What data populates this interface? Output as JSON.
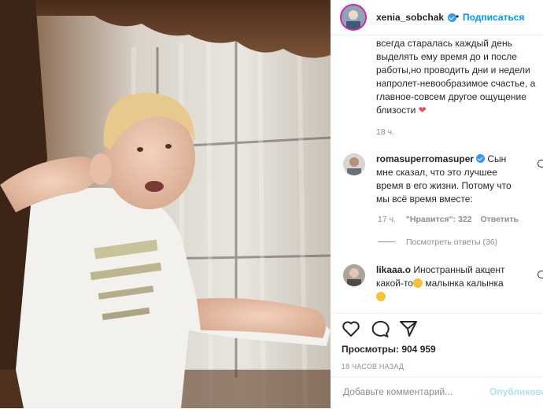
{
  "post": {
    "username": "xenia_sobchak",
    "follow_label": "Подписаться",
    "dot": "•",
    "caption_lines": [
      "всегда старалась каждый день",
      "выделять ему время до и после",
      "работы,но проводить дни и недели",
      "напролет-невообразимое счастье, а",
      "главное-совсем другое ощущение",
      "близости"
    ],
    "caption_time": "18 ч."
  },
  "comments": [
    {
      "username": "romasuperromasuper",
      "text_lines": [
        "Сын",
        "мне сказал, что это лучшее",
        "время в его жизни. Потому что",
        "мы всё время вместе:"
      ],
      "time": "17 ч.",
      "likes": "\"Нравится\": 322",
      "reply_label": "Ответить",
      "view_replies": "Посмотреть ответы (36)"
    },
    {
      "username": "likaaa.o",
      "text_lines": [
        "Иностранный акцент",
        "какой-то",
        "малынка калынка"
      ]
    }
  ],
  "actions": {
    "views_label": "Просмотры: 904 959",
    "time_ago": "18 ЧАСОВ НАЗАД",
    "comment_placeholder": "Добавьте комментарий...",
    "publish_label": "Опубликовать"
  },
  "colors": {
    "accent": "#0095f6",
    "verified": "#3897f0",
    "heart": "#ed4956"
  },
  "icons": [
    "heart-icon",
    "comment-icon",
    "share-icon",
    "verified-icon"
  ]
}
